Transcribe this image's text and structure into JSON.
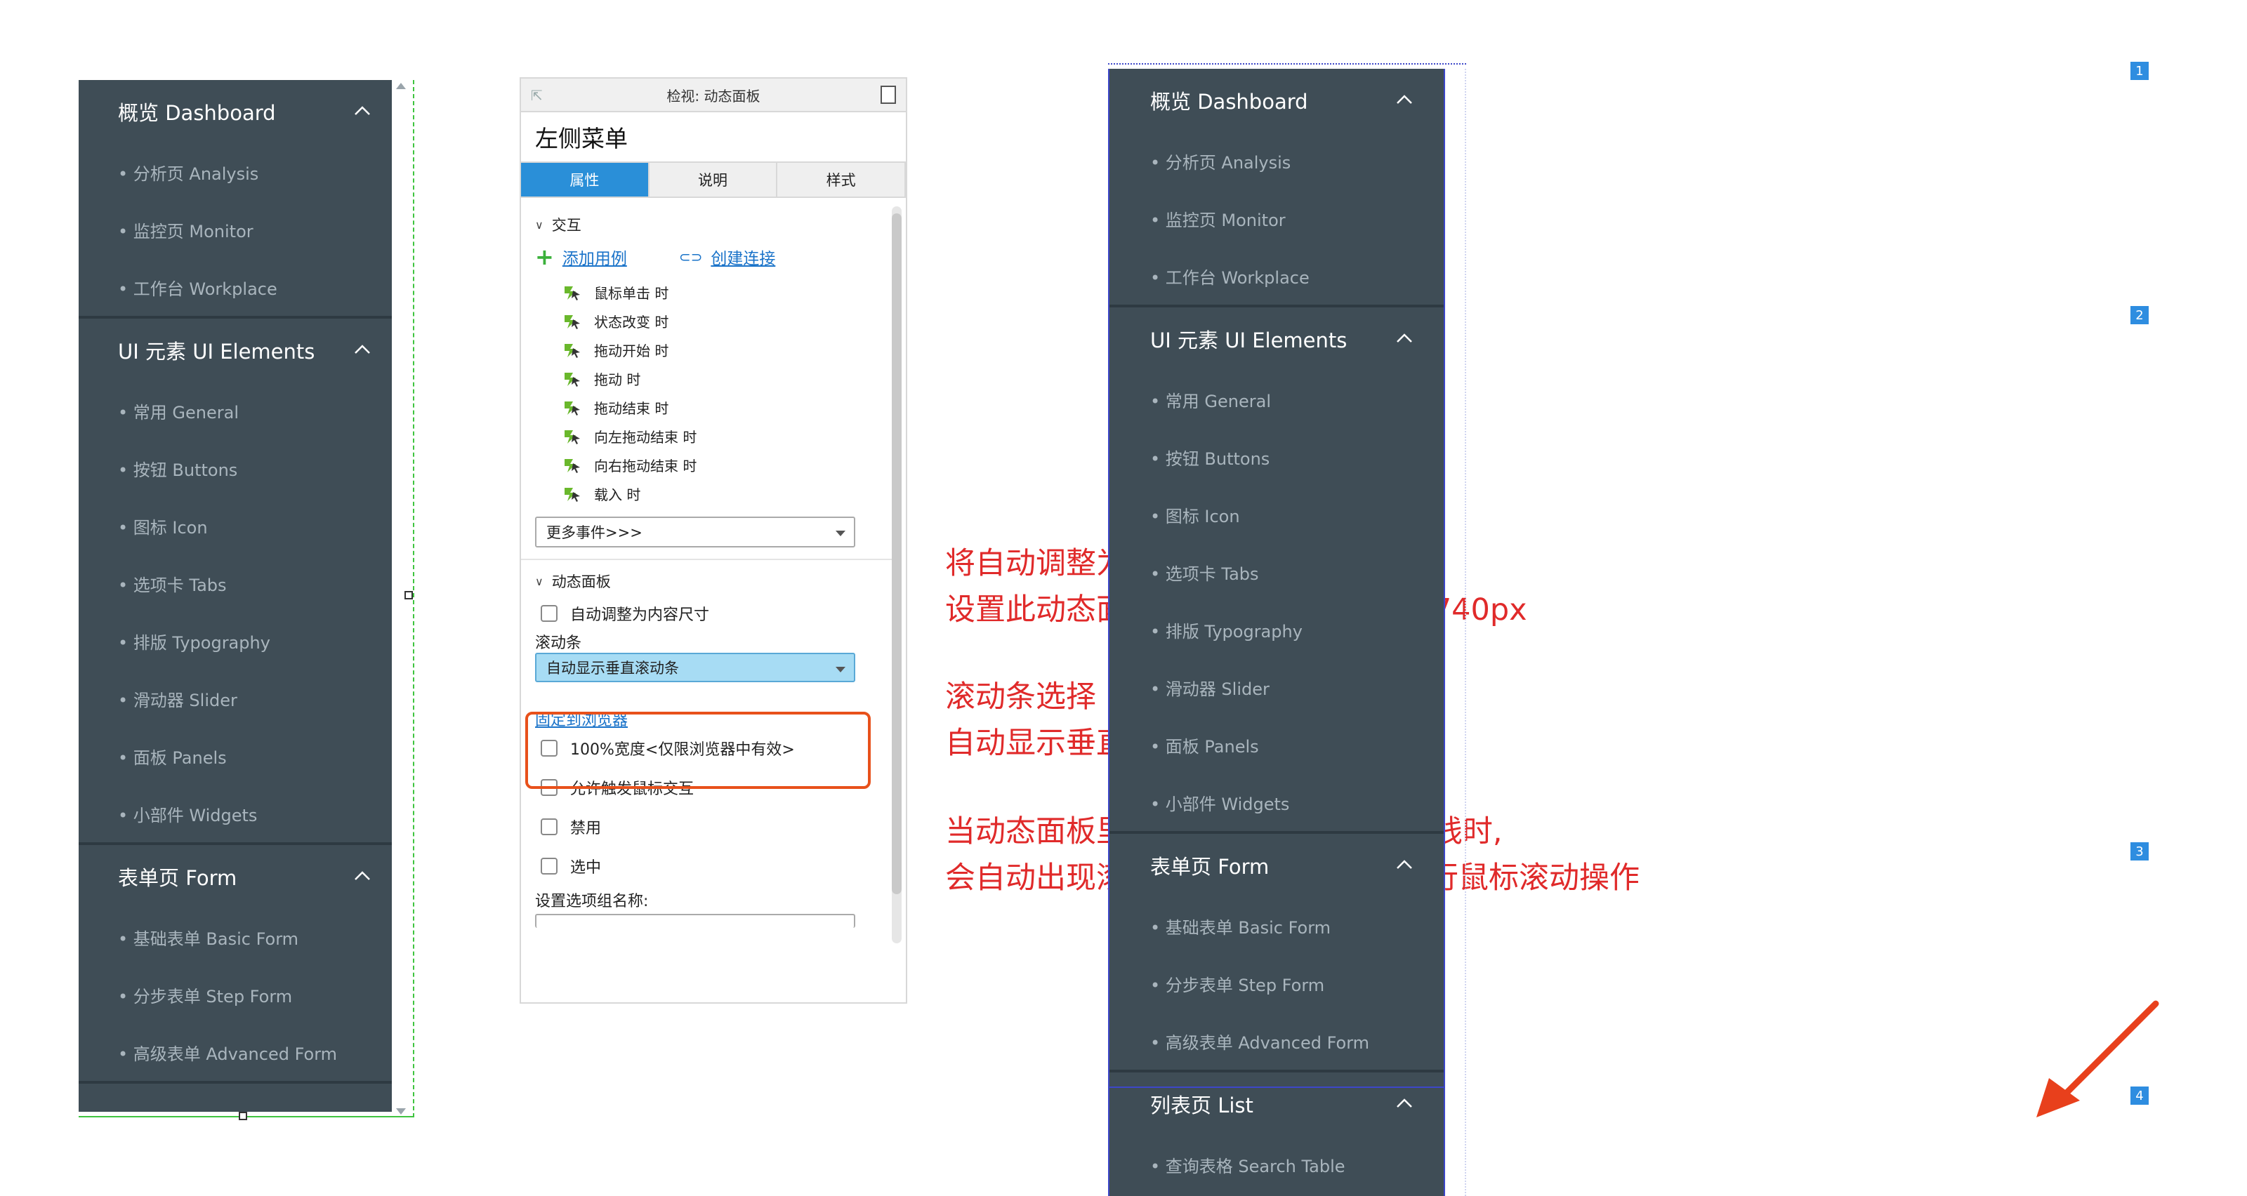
{
  "left_menu": {
    "groups": [
      {
        "title": "概览 Dashboard",
        "items": [
          "• 分析页 Analysis",
          "• 监控页 Monitor",
          "• 工作台 Workplace"
        ]
      },
      {
        "title": "UI 元素 UI Elements",
        "items": [
          "• 常用 General",
          "• 按钮 Buttons",
          "• 图标 Icon",
          "• 选项卡 Tabs",
          "• 排版 Typography",
          "• 滑动器 Slider",
          "• 面板 Panels",
          "• 小部件 Widgets"
        ]
      },
      {
        "title": "表单页 Form",
        "items": [
          "• 基础表单 Basic Form",
          "• 分步表单 Step Form",
          "• 高级表单 Advanced Form"
        ]
      }
    ]
  },
  "inspector": {
    "titlebar": "检视: 动态面板",
    "name": "左侧菜单",
    "tabs": [
      "属性",
      "说明",
      "样式"
    ],
    "interaction_section": "交互",
    "add_case": "添加用例",
    "create_link": "创建连接",
    "events": [
      "鼠标单击 时",
      "状态改变 时",
      "拖动开始 时",
      "拖动 时",
      "拖动结束 时",
      "向左拖动结束 时",
      "向右拖动结束 时",
      "载入 时"
    ],
    "more_events": "更多事件>>>",
    "panel_section": "动态面板",
    "auto_fit": "自动调整为内容尺寸",
    "scrollbar_label": "滚动条",
    "scrollbar_value": "自动显示垂直滚动条",
    "pin_to_browser": "固定到浏览器",
    "full_width": "100%宽度<仅限浏览器中有效>",
    "allow_mouse": "允许触发鼠标交互",
    "disabled": "禁用",
    "selected": "选中",
    "group_name": "设置选项组名称:"
  },
  "notes": {
    "line1": "将自动调整为内容尺寸勾取消,",
    "line2": "设置此动态面板的长为240px，高为740px",
    "line3": "滚动条选择",
    "line4": "自动显示垂直滚动条",
    "line5": "当动态面板里的内容超出高的740px线时,",
    "line6": "会自动出现滚动条可对面板的内容进行鼠标滚动操作"
  },
  "right_menu": {
    "groups": [
      {
        "title": "概览 Dashboard",
        "items": [
          "• 分析页 Analysis",
          "• 监控页 Monitor",
          "• 工作台 Workplace"
        ]
      },
      {
        "title": "UI 元素 UI Elements",
        "items": [
          "• 常用 General",
          "• 按钮 Buttons",
          "• 图标 Icon",
          "• 选项卡 Tabs",
          "• 排版 Typography",
          "• 滑动器 Slider",
          "• 面板 Panels",
          "• 小部件 Widgets"
        ]
      },
      {
        "title": "表单页 Form",
        "items": [
          "• 基础表单 Basic Form",
          "• 分步表单 Step Form",
          "• 高级表单 Advanced Form"
        ]
      },
      {
        "title": "列表页 List",
        "items": [
          "• 查询表格 Search Table"
        ]
      }
    ],
    "badges": [
      "1",
      "2",
      "3",
      "4"
    ]
  },
  "colors": {
    "menu_bg": "#3f4d56",
    "accent_blue": "#2a8fd8",
    "annotation_red": "#e02a2a",
    "highlight_box": "#e8511b"
  }
}
